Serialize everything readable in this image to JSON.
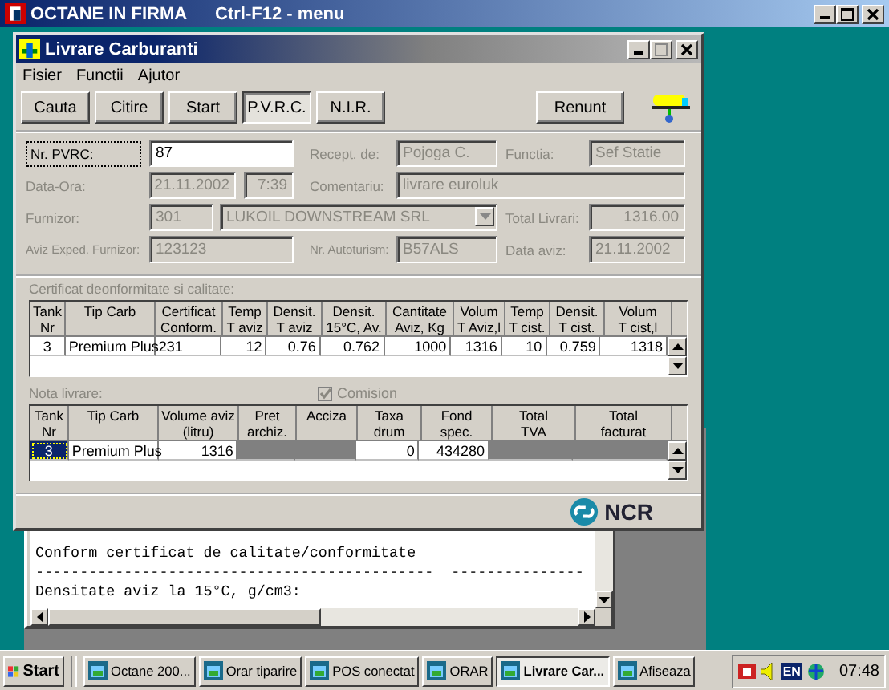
{
  "app_window": {
    "title": "OCTANE IN FIRMA",
    "shortcut_hint": "Ctrl-F12 - menu"
  },
  "dialog": {
    "title": "Livrare Carburanti",
    "menu": [
      "Fisier",
      "Functii",
      "Ajutor"
    ],
    "toolbar": [
      {
        "label": "Cauta",
        "selected": false
      },
      {
        "label": "Citire",
        "selected": false
      },
      {
        "label": "Start",
        "selected": false
      },
      {
        "label": "P.V.R.C.",
        "selected": true
      },
      {
        "label": "N.I.R.",
        "selected": false
      }
    ],
    "cancel_button": "Renunt",
    "form": {
      "pvrc": {
        "label": "Nr. PVRC:",
        "value": "87",
        "disabled": false
      },
      "recept": {
        "label": "Recept. de:",
        "value": "Pojoga C.",
        "disabled": true
      },
      "functia": {
        "label": "Functia:",
        "value": "Sef Statie",
        "disabled": true
      },
      "data_ora": {
        "label": "Data-Ora:",
        "date": "21.11.2002",
        "time": "7:39",
        "disabled": true
      },
      "comentariu": {
        "label": "Comentariu:",
        "value": "livrare euroluk",
        "disabled": true
      },
      "furnizor": {
        "label": "Furnizor:",
        "code": "301",
        "name": "LUKOIL DOWNSTREAM SRL",
        "disabled": true
      },
      "total_livrari": {
        "label": "Total Livrari:",
        "value": "1316.00",
        "disabled": true
      },
      "aviz_exped": {
        "label": "Aviz Exped. Furnizor:",
        "value": "123123",
        "disabled": true
      },
      "nr_auto": {
        "label": "Nr. Autoturism:",
        "value": "B57ALS",
        "disabled": true
      },
      "data_aviz": {
        "label": "Data aviz:",
        "value": "21.11.2002",
        "disabled": true
      }
    },
    "certificate": {
      "title": "Certificat deonformitate si calitate:",
      "columns": [
        "Tank\nNr",
        "Tip Carb",
        "Certificat\nConform.",
        "Temp\nT aviz",
        "Densit.\nT aviz",
        "Densit.\n15°C, Av.",
        "Cantitate\nAviz, Kg",
        "Volum\nT Aviz,l",
        "Temp\nT cist.",
        "Densit.\nT cist.",
        "Volum\nT cist,l"
      ],
      "rows": [
        [
          "3",
          "Premium Plus",
          "231",
          "12",
          "0.76",
          "0.762",
          "1000",
          "1316",
          "10",
          "0.759",
          "1318"
        ]
      ]
    },
    "nota": {
      "title": "Nota livrare:",
      "comision": {
        "label": "Comision",
        "checked": true,
        "disabled": true
      },
      "columns": [
        "Tank\nNr",
        "Tip Carb",
        "Volume aviz\n(litru)",
        "Pret\narchiz.",
        "Acciza",
        "Taxa\ndrum",
        "Fond\nspec.",
        "Total\nTVA",
        "Total\nfacturat"
      ],
      "rows": [
        [
          {
            "value": "3",
            "selected": true,
            "disabled": false
          },
          {
            "value": "Premium Plus",
            "selected": false,
            "disabled": false
          },
          {
            "value": "1316",
            "selected": false,
            "disabled": false
          },
          {
            "selected": false,
            "disabled": true
          },
          {
            "selected": false,
            "disabled": true
          },
          {
            "value": "0",
            "selected": false,
            "disabled": false
          },
          {
            "value": "434280",
            "selected": false,
            "disabled": false
          },
          {
            "selected": false,
            "disabled": true
          },
          {
            "selected": false,
            "disabled": true
          }
        ]
      ]
    },
    "brand": "NCR"
  },
  "report": {
    "lines": [
      "Conform certificat de calitate/conformitate",
      "---------------------------------------------  ---------------",
      "Densitate aviz la 15°C, g/cm3:"
    ]
  },
  "taskbar": {
    "start": "Start",
    "tasks": [
      {
        "label": "Octane 200...",
        "selected": false
      },
      {
        "label": "Orar tiparire",
        "selected": false
      },
      {
        "label": "POS conectat",
        "selected": false
      },
      {
        "label": "ORAR",
        "selected": false
      },
      {
        "label": "Livrare Car...",
        "selected": true
      },
      {
        "label": "Afiseaza",
        "selected": false
      }
    ],
    "language": "EN",
    "clock": "07:48"
  }
}
